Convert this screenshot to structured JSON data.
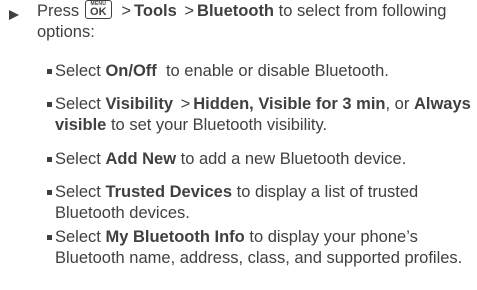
{
  "instruction": {
    "pre": "Press",
    "key": {
      "top": "MENU",
      "main": "OK"
    },
    "sep1": ">",
    "tools": "Tools",
    "sep2": ">",
    "bluetooth": "Bluetooth",
    "post": "to select from following options:"
  },
  "options": [
    {
      "pre": "Select",
      "bold": "On/Off",
      "post": "to enable or disable Bluetooth."
    },
    {
      "pre": "Select",
      "bold": "Visibility",
      "sep": ">",
      "b2": "Hidden,",
      "b3": "Visible for 3 min",
      "mid": ", or",
      "b4": "Always visible",
      "post": "to set your Bluetooth visibility."
    },
    {
      "pre": "Select",
      "bold": "Add New",
      "post": "to add a new Bluetooth device."
    },
    {
      "pre": "Select",
      "bold": "Trusted Devices",
      "post": "to display a list of trusted Bluetooth devices."
    },
    {
      "pre": "Select",
      "bold": "My Bluetooth Info",
      "post": "to display your phone’s Bluetooth name, address, class, and supported profiles."
    }
  ]
}
